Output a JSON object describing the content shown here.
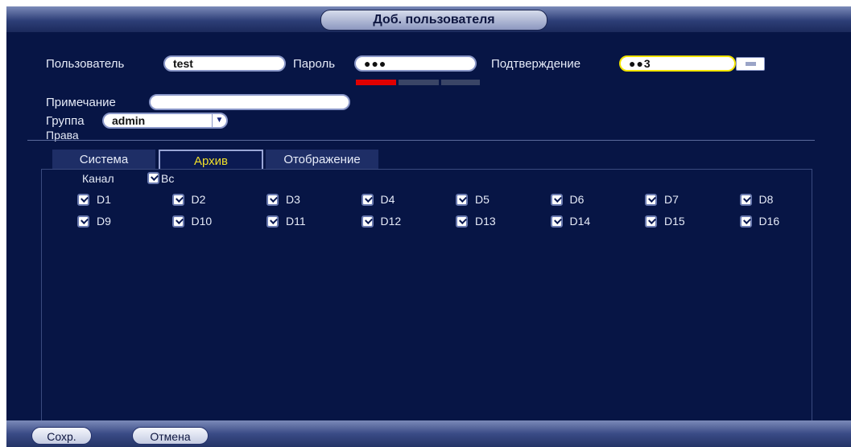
{
  "dialog": {
    "title": "Доб. пользователя"
  },
  "form": {
    "user_label": "Пользователь",
    "user_value": "test",
    "password_label": "Пароль",
    "password_value": "●●●",
    "confirm_label": "Подтверждение",
    "confirm_value": "●●3",
    "note_label": "Примечание",
    "note_value": "",
    "group_label": "Группа",
    "group_value": "admin",
    "rights_label": "Права",
    "strength_colors": [
      "#e00000",
      "#3a4566",
      "#3a4566"
    ]
  },
  "tabs": [
    {
      "label": "Система"
    },
    {
      "label": "Архив"
    },
    {
      "label": "Отображение"
    }
  ],
  "channels": {
    "header_label": "Канал",
    "all_label": "Вс",
    "row1": [
      "D1",
      "D2",
      "D3",
      "D4",
      "D5",
      "D6",
      "D7",
      "D8"
    ],
    "row2": [
      "D9",
      "D10",
      "D11",
      "D12",
      "D13",
      "D14",
      "D15",
      "D16"
    ]
  },
  "footer": {
    "save_label": "Сохр.",
    "cancel_label": "Отмена"
  }
}
